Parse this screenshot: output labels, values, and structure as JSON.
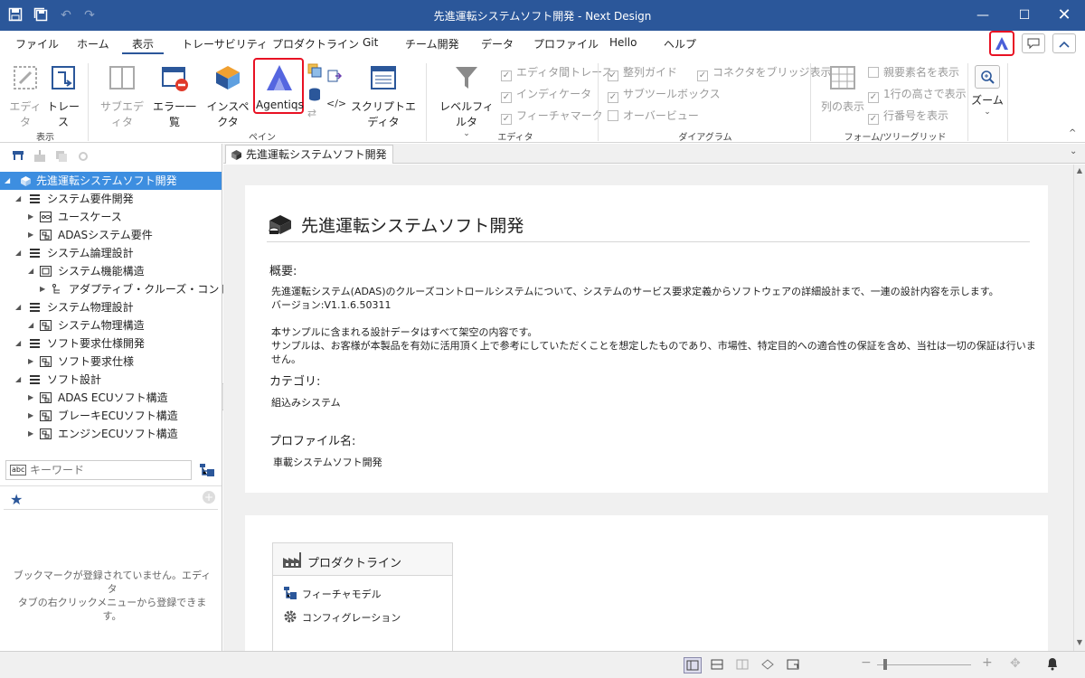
{
  "window": {
    "title": "先進運転システムソフト開発 - Next Design"
  },
  "menu": {
    "tabs": [
      "ファイル",
      "ホーム",
      "表示",
      "トレーサビリティ",
      "プロダクトライン",
      "Git",
      "チーム開発",
      "データ",
      "プロファイル",
      "Hello",
      "ヘルプ"
    ],
    "active": "表示"
  },
  "ribbon": {
    "display": {
      "editor": "エディタ",
      "trace": "トレース",
      "group": "表示"
    },
    "pane": {
      "sub_editor": "サブエディタ",
      "error_list": "エラー一覧",
      "inspector": "インスペクタ",
      "agentiqs": "Agentiqs",
      "script_editor": "スクリプトエディタ",
      "group": "ペイン"
    },
    "editor": {
      "level_filter": "レベルフィルタ",
      "inter_editor_trace": "エディタ間トレース",
      "indicator": "インディケータ",
      "feature_mark": "フィーチャマーク",
      "group": "エディタ"
    },
    "diagram": {
      "align_guide": "整列ガイド",
      "sub_toolbox": "サブツールボックス",
      "overview": "オーバービュー",
      "connector_bridge": "コネクタをブリッジ表示",
      "group": "ダイアグラム"
    },
    "form": {
      "column_display": "列の表示",
      "parent_name": "親要素名を表示",
      "single_row": "1行の高さで表示",
      "row_number": "行番号を表示",
      "group": "フォーム/ツリーグリッド"
    },
    "zoom": {
      "label": "ズーム"
    }
  },
  "tree": {
    "root": "先進運転システムソフト開発",
    "items": [
      {
        "label": "システム要件開発"
      },
      {
        "label": "ユースケース"
      },
      {
        "label": "ADASシステム要件"
      },
      {
        "label": "システム論理設計"
      },
      {
        "label": "システム機能構造"
      },
      {
        "label": "アダプティブ・クルーズ・コントロール"
      },
      {
        "label": "システム物理設計"
      },
      {
        "label": "システム物理構造"
      },
      {
        "label": "ソフト要求仕様開発"
      },
      {
        "label": "ソフト要求仕様"
      },
      {
        "label": "ソフト設計"
      },
      {
        "label": "ADAS ECUソフト構造"
      },
      {
        "label": "ブレーキECUソフト構造"
      },
      {
        "label": "エンジンECUソフト構造"
      }
    ]
  },
  "search": {
    "placeholder": "キーワード"
  },
  "bookmarks": {
    "empty": "ブックマークが登録されていません。エディタタブの右クリックメニューから登録できます。",
    "empty_line1": "ブックマークが登録されていません。エディタ",
    "empty_line2": "タブの右クリックメニューから登録できます。"
  },
  "doc": {
    "tab": "先進運転システムソフト開発",
    "title": "先進運転システムソフト開発",
    "overview_label": "概要:",
    "overview_line1": "先進運転システム(ADAS)のクルーズコントロールシステムについて、システムのサービス要求定義からソフトウェアの詳細設計まで、一連の設計内容を示します。",
    "overview_line2": "バージョン:V1.1.6.50311",
    "overview_line3": "本サンプルに含まれる設計データはすべて架空の内容です。",
    "overview_line4": "サンプルは、お客様が本製品を有効に活用頂く上で参考にしていただくことを想定したものであり、市場性、特定目的への適合性の保証を含め、当社は一切の保証は行いません。",
    "category_label": "カテゴリ:",
    "category_value": "組込みシステム",
    "profile_label": "プロファイル名:",
    "profile_value": "車載システムソフト開発"
  },
  "productline": {
    "title": "プロダクトライン",
    "items": [
      "フィーチャモデル",
      "コンフィグレーション"
    ]
  },
  "colors": {
    "titlebar": "#2b579a",
    "selection": "#3d8ee0",
    "highlight": "#e81123"
  }
}
